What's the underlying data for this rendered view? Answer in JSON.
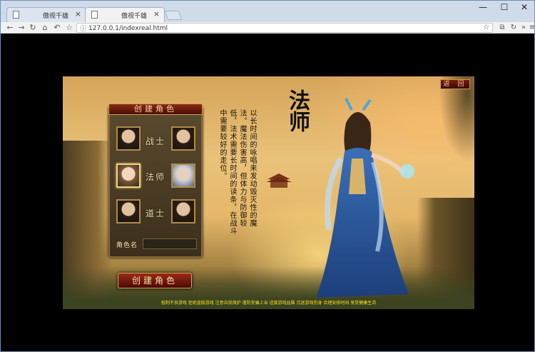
{
  "browser": {
    "tabs": [
      {
        "title": "傲视千雄",
        "active": false
      },
      {
        "title": "傲视千雄",
        "active": true
      }
    ],
    "url": "127.0.0.1/indexreal.html",
    "window_controls": {
      "minimize": "—",
      "maximize": "☐",
      "close": "✕"
    }
  },
  "game": {
    "back_button": "返 回",
    "panel_title": "创建角色",
    "classes": [
      {
        "label": "战士",
        "selected": false
      },
      {
        "label": "法师",
        "selected": true
      },
      {
        "label": "道士",
        "selected": false
      }
    ],
    "name_label": "角色名",
    "name_value": "",
    "create_button": "创建角色",
    "class_title": "法师",
    "description": "以长时间的咏唱来发动毁灭性的魔法。魔法伤害高，但体力与防御较低，法术需要长时间的读条，在战斗中需要较好的走位。",
    "footer": "抵制不良游戏 拒绝盗版游戏 注意自我保护 谨防受骗上当 适度游戏益脑 沉迷游戏伤身 合理安排时间 享受健康生活"
  },
  "colors": {
    "accent_gold": "#d8a850",
    "button_red": "#9a2a18",
    "footer_yellow": "#f0e020"
  }
}
